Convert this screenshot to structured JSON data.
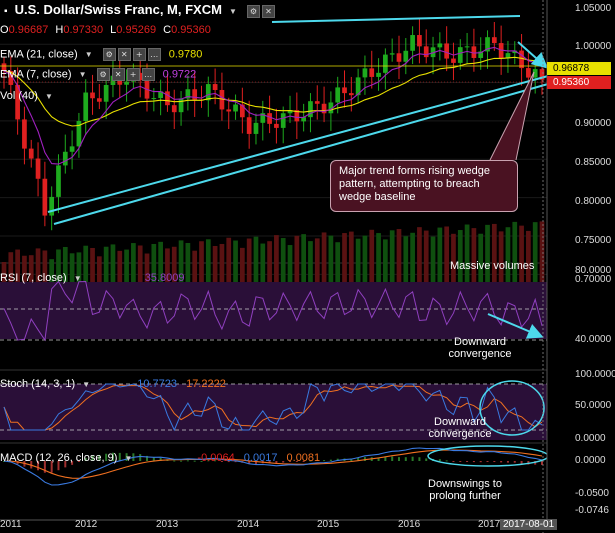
{
  "header": {
    "title": "U.S. Dollar/Swiss Franc, M, FXCM",
    "ohlc": [
      {
        "k": "O",
        "v": "0.96687"
      },
      {
        "k": "H",
        "v": "0.97330"
      },
      {
        "k": "L",
        "v": "0.95269"
      },
      {
        "k": "C",
        "v": "0.95360"
      }
    ]
  },
  "indicators": {
    "ema21": {
      "label": "EMA (21, close)",
      "value": "0.9780"
    },
    "ema7": {
      "label": "EMA (7, close)",
      "value": "0.9722"
    },
    "vol": {
      "label": "Vol (40)"
    },
    "rsi": {
      "label": "RSI (7, close)",
      "value": "35.8009"
    },
    "stoch": {
      "label": "Stoch (14, 3, 1)",
      "k": "10.7723",
      "d": "17.2222"
    },
    "macd": {
      "label": "MACD (12, 26, close, 9)",
      "hist": "-0.0064",
      "macd": "0.0017",
      "signal": "0.0081"
    }
  },
  "price_axis": {
    "ticks": [
      "1.05000",
      "1.00000",
      "0.95000",
      "0.90000",
      "0.85000",
      "0.80000",
      "0.75000",
      "0.70000"
    ],
    "tag_ema": "0.96878",
    "tag_close": "0.95360"
  },
  "rsi_axis": [
    "80.0000",
    "40.0000"
  ],
  "stoch_axis": [
    "100.0000",
    "50.0000",
    "0.0000"
  ],
  "macd_axis": [
    "0.0000",
    "-0.0500",
    "-0.0746"
  ],
  "time_axis": [
    "2011",
    "2012",
    "2013",
    "2014",
    "2015",
    "2016",
    "2017",
    "2017-08-01"
  ],
  "annotations": {
    "callout": "Major trend forms rising wedge pattern, attempting to breach wedge baseline",
    "volumes": "Massive volumes",
    "rsi": "Downward convergence",
    "stoch": "Downward convergence",
    "macd": "Downswings to prolong further"
  },
  "colors": {
    "up": "#1eab1e",
    "down": "#e02020",
    "ema21": "#e8e000",
    "ema7": "#a020c0",
    "trend": "#4dd9ec",
    "rsi": "#9040c0",
    "stoch_k": "#3a7ae0",
    "stoch_d": "#f07020"
  },
  "chart_data": {
    "type": "candlestick",
    "title": "U.S. Dollar/Swiss Franc, M, FXCM",
    "interval": "monthly",
    "x": [
      "2011-01",
      "2011-07",
      "2012-01",
      "2012-07",
      "2013-01",
      "2013-07",
      "2014-01",
      "2014-07",
      "2015-01",
      "2015-07",
      "2016-01",
      "2016-07",
      "2017-01",
      "2017-08"
    ],
    "close": [
      0.965,
      0.785,
      0.925,
      0.96,
      0.92,
      0.94,
      0.895,
      0.905,
      0.925,
      0.965,
      1.0,
      0.985,
      1.0,
      0.9536
    ],
    "ylim": [
      0.69,
      1.055
    ],
    "series": [
      {
        "name": "EMA (21, close)",
        "last": 0.978
      },
      {
        "name": "EMA (7, close)",
        "last": 0.9722
      }
    ],
    "rsi_last": 35.8009,
    "stoch_last": {
      "k": 10.7723,
      "d": 17.2222
    },
    "macd_last": {
      "hist": -0.0064,
      "macd": 0.0017,
      "signal": 0.0081
    }
  }
}
